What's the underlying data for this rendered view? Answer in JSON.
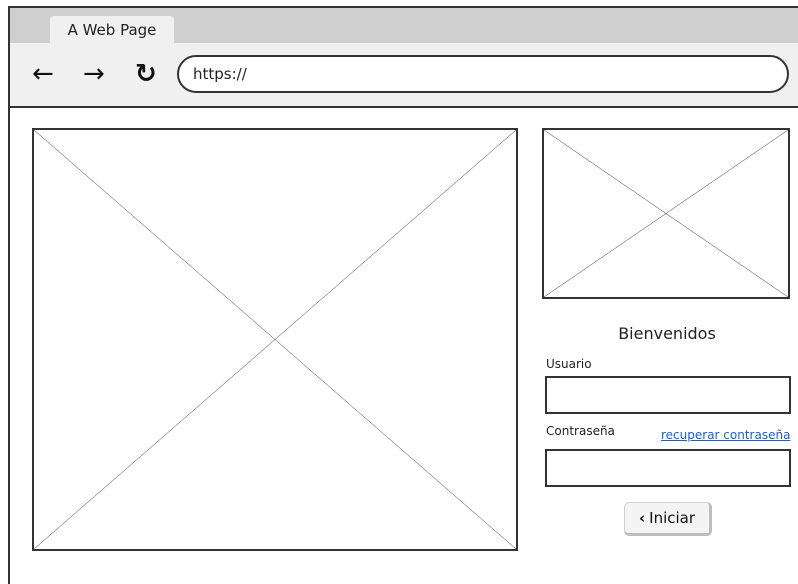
{
  "browser": {
    "tab_title": "A Web Page",
    "address": "https://",
    "nav": {
      "back_icon": "arrow-left-icon",
      "forward_icon": "arrow-right-icon",
      "reload_icon": "reload-icon"
    }
  },
  "login": {
    "welcome": "Bienvenidos",
    "user_label": "Usuario",
    "user_value": "",
    "password_label": "Contraseña",
    "password_value": "",
    "recover_link": "recuperar contraseña",
    "submit_label": "Iniciar",
    "submit_icon": "chevron-left-icon"
  },
  "colors": {
    "link": "#1a5fd6",
    "chrome": "#cfcfcf",
    "toolbar": "#f0f0f0"
  }
}
